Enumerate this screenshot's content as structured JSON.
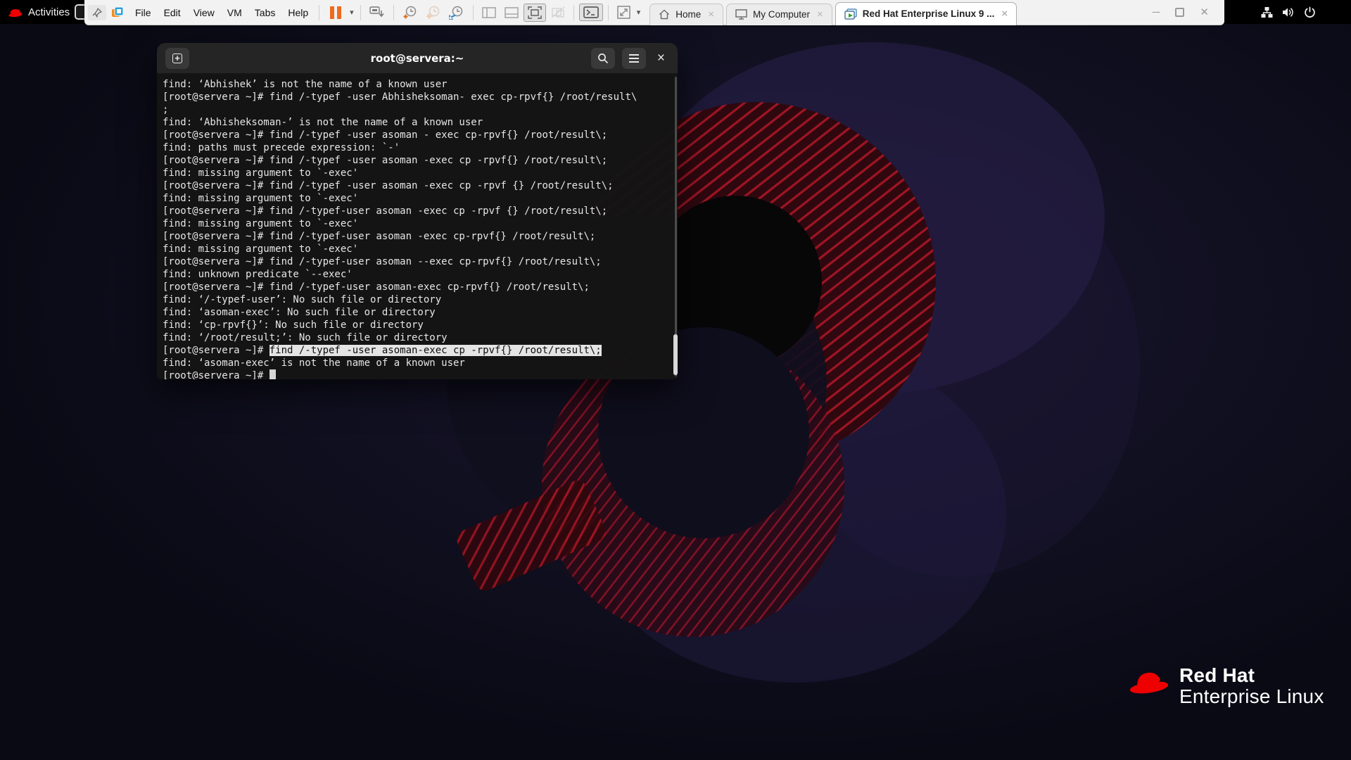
{
  "gnome_bar": {
    "activities": "Activities"
  },
  "toolbar": {
    "menus": [
      "File",
      "Edit",
      "View",
      "VM",
      "Tabs",
      "Help"
    ],
    "tabs": [
      {
        "label": "Home"
      },
      {
        "label": "My Computer"
      },
      {
        "label": "Red Hat Enterprise Linux 9 ..."
      }
    ]
  },
  "icons": {
    "caret": "▾",
    "tab_close": "×",
    "win_min": "─",
    "win_close": "✕",
    "console_glyph": ">_",
    "new_tab_plus": "+",
    "term_close": "×"
  },
  "terminal": {
    "title": "root@servera:~",
    "lines": [
      {
        "pre": "find: ‘Abhishek’ is not the name of a known user"
      },
      {
        "pre": "[root@servera ~]# find /-typef -user Abhisheksoman- exec cp-rpvf{} /root/result\\"
      },
      {
        "pre": ";"
      },
      {
        "pre": "find: ‘Abhisheksoman-’ is not the name of a known user"
      },
      {
        "pre": "[root@servera ~]# find /-typef -user asoman - exec cp-rpvf{} /root/result\\;"
      },
      {
        "pre": "find: paths must precede expression: `-'"
      },
      {
        "pre": "[root@servera ~]# find /-typef -user asoman -exec cp -rpvf{} /root/result\\;"
      },
      {
        "pre": "find: missing argument to `-exec'"
      },
      {
        "pre": "[root@servera ~]# find /-typef -user asoman -exec cp -rpvf {} /root/result\\;"
      },
      {
        "pre": "find: missing argument to `-exec'"
      },
      {
        "pre": "[root@servera ~]# find /-typef-user asoman -exec cp -rpvf {} /root/result\\;"
      },
      {
        "pre": "find: missing argument to `-exec'"
      },
      {
        "pre": "[root@servera ~]# find /-typef-user asoman -exec cp-rpvf{} /root/result\\;"
      },
      {
        "pre": "find: missing argument to `-exec'"
      },
      {
        "pre": "[root@servera ~]# find /-typef-user asoman --exec cp-rpvf{} /root/result\\;"
      },
      {
        "pre": "find: unknown predicate `--exec'"
      },
      {
        "pre": "[root@servera ~]# find /-typef-user asoman-exec cp-rpvf{} /root/result\\;"
      },
      {
        "pre": "find: ‘/-typef-user’: No such file or directory"
      },
      {
        "pre": "find: ‘asoman-exec’: No such file or directory"
      },
      {
        "pre": "find: ‘cp-rpvf{}’: No such file or directory"
      },
      {
        "pre": "find: ‘/root/result;’: No such file or directory"
      },
      {
        "pre": "[root@servera ~]# ",
        "hl": "find /-typef -user asoman-exec cp -rpvf{} /root/result\\;"
      },
      {
        "pre": "find: ‘asoman-exec’ is not the name of a known user"
      },
      {
        "pre": "[root@servera ~]# ",
        "cursor": true
      }
    ]
  },
  "branding": {
    "name": "Red Hat",
    "product": "Enterprise Linux"
  },
  "colors": {
    "redhat_red": "#ee0000",
    "vmware_orange": "#ee6b1e",
    "snapshot_blue": "#2f88c7",
    "stripe_red": "#a61522",
    "desktop_navy": "#0a0a15"
  }
}
